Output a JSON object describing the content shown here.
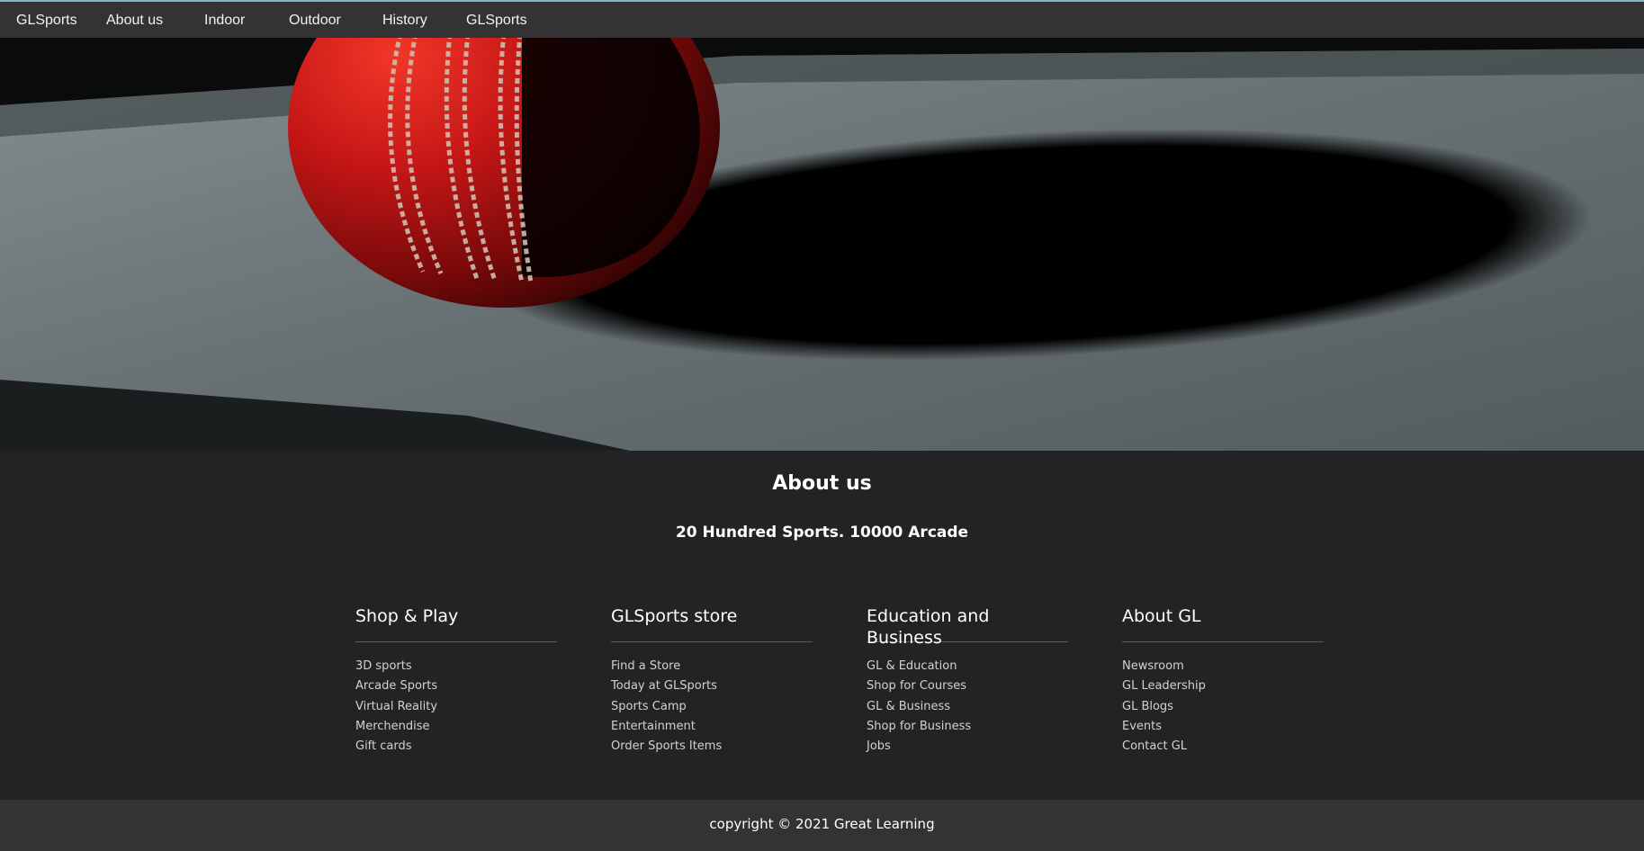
{
  "nav": {
    "items": [
      {
        "label": "GLSports"
      },
      {
        "label": "About us"
      },
      {
        "label": "Indoor"
      },
      {
        "label": "Outdoor"
      },
      {
        "label": "History"
      },
      {
        "label": "GLSports"
      }
    ]
  },
  "hero": {
    "image_subject": "cricket-ball-with-shadow"
  },
  "about": {
    "title": "About us",
    "subtitle": "20 Hundred Sports. 10000 Arcade"
  },
  "footer_columns": [
    {
      "title": "Shop & Play",
      "links": [
        "3D sports",
        "Arcade Sports",
        "Virtual Reality",
        "Merchendise",
        "Gift cards"
      ]
    },
    {
      "title": "GLSports store",
      "links": [
        "Find a Store",
        "Today at GLSports",
        "Sports Camp",
        "Entertainment",
        "Order Sports Items"
      ]
    },
    {
      "title": "Education and Business",
      "links": [
        "GL & Education",
        "Shop for Courses",
        "GL & Business",
        "Shop for Business",
        "Jobs"
      ]
    },
    {
      "title": "About GL",
      "links": [
        "Newsroom",
        "GL Leadership",
        "GL Blogs",
        "Events",
        "Contact GL"
      ]
    }
  ],
  "footer": {
    "copyright": "copyright © 2021 Great Learning"
  },
  "colors": {
    "nav_bg": "#333333",
    "nav_accent": "#7fb8c4",
    "section_bg": "#232325",
    "footer_bg": "#333333",
    "ball_red": "#c4141a"
  }
}
